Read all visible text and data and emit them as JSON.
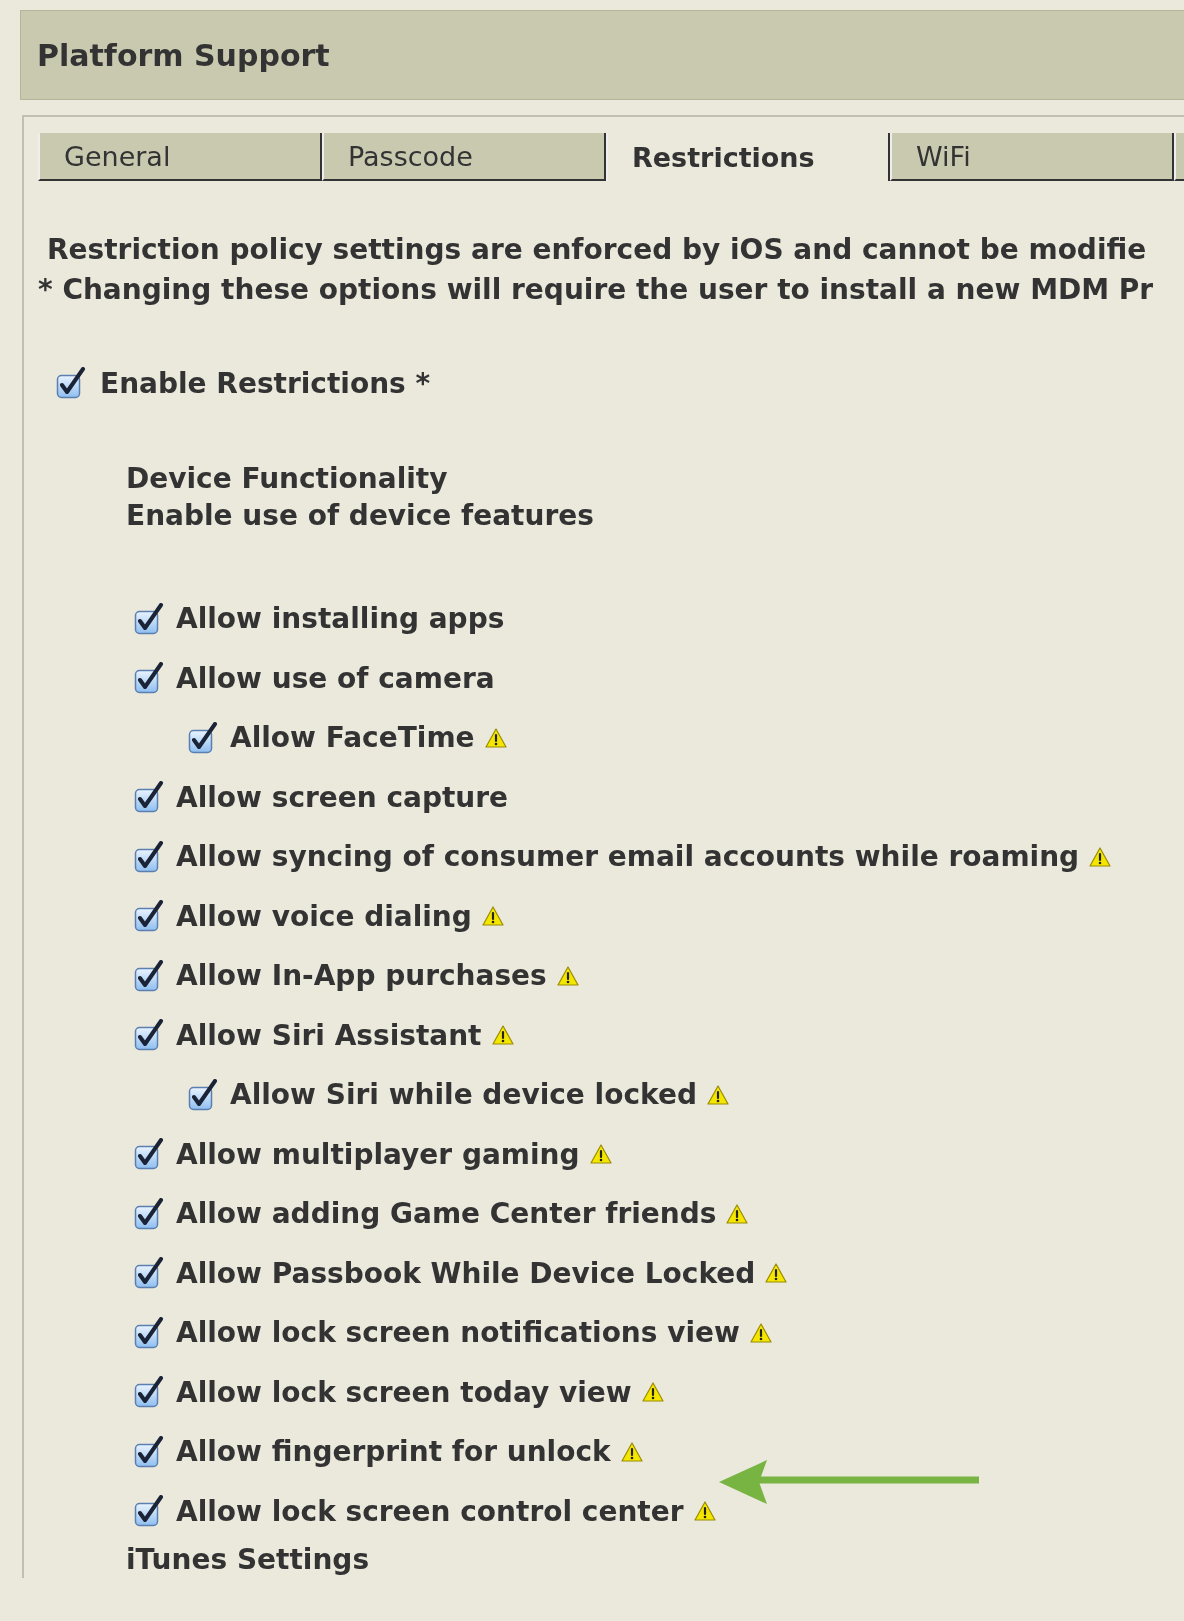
{
  "header": {
    "title": "Platform Support"
  },
  "tabs": [
    {
      "label": "General",
      "selected": false
    },
    {
      "label": "Passcode",
      "selected": false
    },
    {
      "label": "Restrictions",
      "selected": true
    },
    {
      "label": "WiFi",
      "selected": false
    }
  ],
  "notes": [
    "Restriction policy settings are enforced by iOS and cannot be modifie",
    "* Changing these options will require the user to install a new MDM Pr"
  ],
  "enable_restrictions": {
    "label": "Enable Restrictions *",
    "checked": true
  },
  "section": {
    "title": "Device Functionality",
    "subtitle": "Enable use of device features"
  },
  "options": [
    {
      "label": "Allow installing apps",
      "checked": true,
      "warning": false
    },
    {
      "label": "Allow use of camera",
      "checked": true,
      "warning": false,
      "children": [
        {
          "label": "Allow FaceTime",
          "checked": true,
          "warning": true
        }
      ]
    },
    {
      "label": "Allow screen capture",
      "checked": true,
      "warning": false
    },
    {
      "label": "Allow syncing of consumer email accounts while roaming",
      "checked": true,
      "warning": true
    },
    {
      "label": "Allow voice dialing",
      "checked": true,
      "warning": true
    },
    {
      "label": "Allow In-App purchases",
      "checked": true,
      "warning": true
    },
    {
      "label": "Allow Siri Assistant",
      "checked": true,
      "warning": true,
      "children": [
        {
          "label": "Allow Siri while device locked",
          "checked": true,
          "warning": true
        }
      ]
    },
    {
      "label": "Allow multiplayer gaming",
      "checked": true,
      "warning": true
    },
    {
      "label": "Allow adding Game Center friends",
      "checked": true,
      "warning": true
    },
    {
      "label": "Allow Passbook While Device Locked",
      "checked": true,
      "warning": true
    },
    {
      "label": "Allow lock screen notifications view",
      "checked": true,
      "warning": true
    },
    {
      "label": "Allow lock screen today view",
      "checked": true,
      "warning": true
    },
    {
      "label": "Allow fingerprint for unlock",
      "checked": true,
      "warning": true
    },
    {
      "label": "Allow lock screen control center",
      "checked": true,
      "warning": true
    }
  ],
  "next_section": {
    "title": "iTunes Settings"
  }
}
